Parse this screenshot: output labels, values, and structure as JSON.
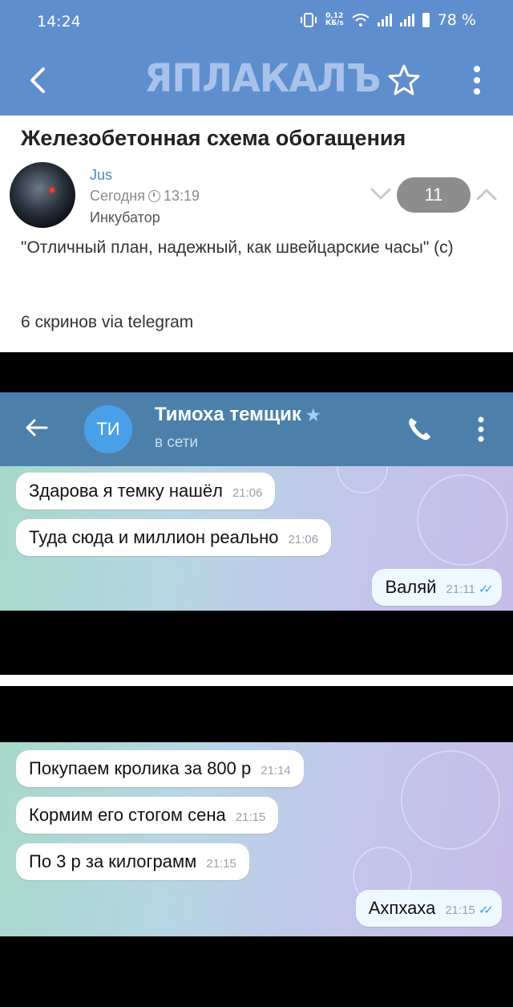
{
  "status_bar": {
    "time": "14:24",
    "net_speed_value": "0,12",
    "net_speed_unit": "КБ/s",
    "battery": "78 %"
  },
  "app_bar": {
    "logo": "ЯПЛАКАЛЪ",
    "back_icon": "back-arrow-icon",
    "star_icon": "star-outline-icon",
    "menu_icon": "more-vert-icon"
  },
  "post": {
    "title": "Железобетонная схема обогащения",
    "author": "Jus",
    "date": "Сегодня",
    "time": "13:19",
    "category": "Инкубатор",
    "rating": "11",
    "text": "\"Отличный план, надежный, как швейцарские часы\" (с)",
    "subtext": "6 скринов via telegram"
  },
  "screenshot1": {
    "contact_initials": "ТИ",
    "contact_name": "Тимоха темщик",
    "contact_status": "в сети",
    "messages": [
      {
        "text": "Здарова я темку нашёл",
        "time": "21:06",
        "outgoing": false
      },
      {
        "text": "Туда сюда и миллион реально",
        "time": "21:06",
        "outgoing": false
      },
      {
        "text": "Валяй",
        "time": "21:11",
        "outgoing": true
      }
    ]
  },
  "screenshot2": {
    "messages": [
      {
        "text": "Покупаем кролика за 800 р",
        "time": "21:14",
        "outgoing": false
      },
      {
        "text": "Кормим его стогом сена",
        "time": "21:15",
        "outgoing": false
      },
      {
        "text": "По 3 р за килограмм",
        "time": "21:15",
        "outgoing": false
      },
      {
        "text": "Ахпхаха",
        "time": "21:15",
        "outgoing": true
      }
    ]
  },
  "colors": {
    "app_bar": "#5f8ecf",
    "author_link": "#4f86c6",
    "rating_pill": "#8d8d8d",
    "telegram_header": "#4c80ab",
    "telegram_avatar": "#4aa0e6"
  }
}
